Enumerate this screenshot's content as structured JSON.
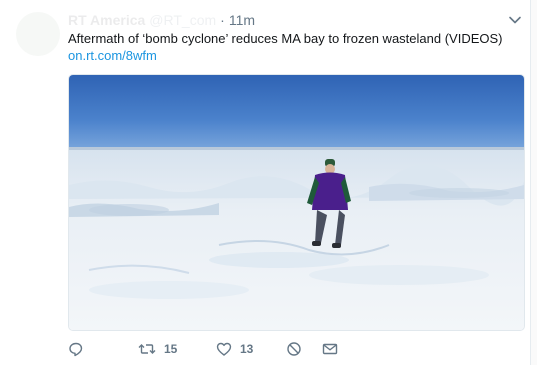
{
  "tweet": {
    "display_name": "RT America",
    "screen_name": "@RT_com",
    "separator": "·",
    "timestamp": "11m",
    "text": "Aftermath of ‘bomb cyclone’ reduces MA bay to frozen wasteland (VIDEOS)",
    "link": "on.rt.com/8wfm"
  },
  "media": {
    "description_icon": "video-thumbnail"
  },
  "actions": {
    "reply_icon": "reply-icon",
    "retweet_count": "15",
    "like_count": "13",
    "block_icon": "block-icon",
    "message_icon": "direct-message-icon"
  },
  "colors": {
    "accent": "#1b95e0",
    "muted": "#657786",
    "text": "#14171a"
  }
}
